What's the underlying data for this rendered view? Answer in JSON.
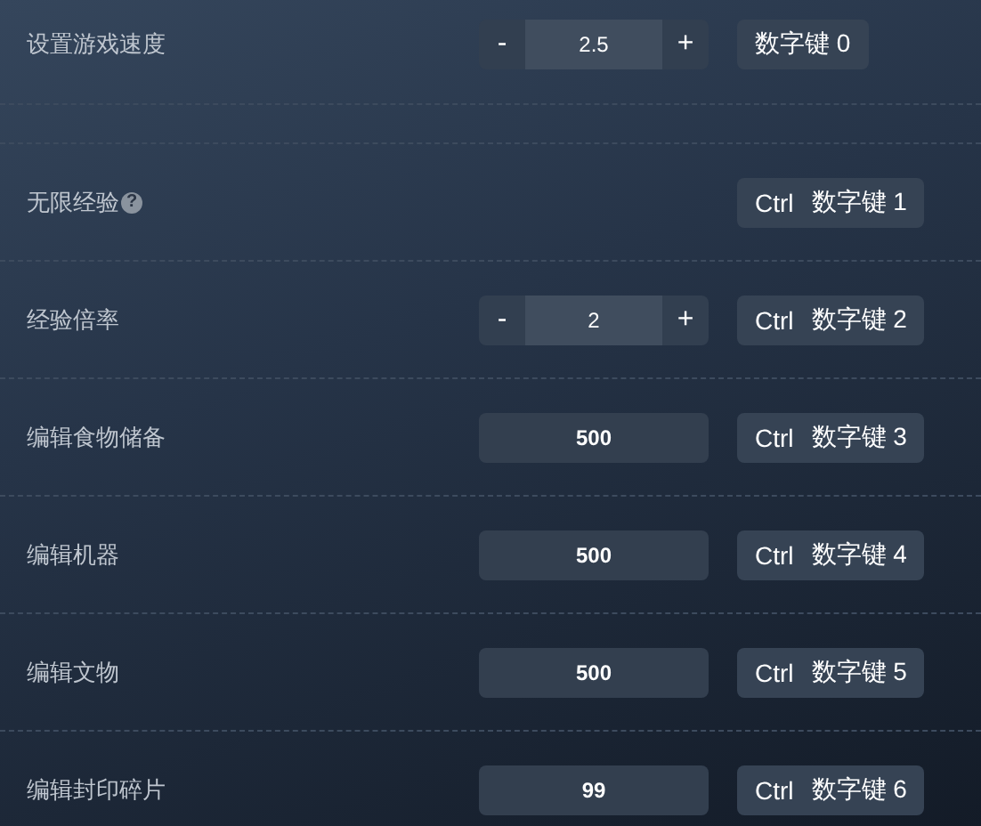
{
  "groups": [
    [
      {
        "label": "设置游戏速度",
        "kind": "stepper",
        "minus": "-",
        "value": "2.5",
        "plus": "+",
        "keys": [
          "数字键 0"
        ]
      }
    ],
    [
      {
        "label": "无限经验",
        "help": "?",
        "kind": "toggle",
        "keys": [
          "Ctrl",
          "数字键 1"
        ]
      },
      {
        "label": "经验倍率",
        "kind": "stepper",
        "minus": "-",
        "value": "2",
        "plus": "+",
        "keys": [
          "Ctrl",
          "数字键 2"
        ]
      },
      {
        "label": "编辑食物储备",
        "kind": "input",
        "value": "500",
        "keys": [
          "Ctrl",
          "数字键 3"
        ]
      },
      {
        "label": "编辑机器",
        "kind": "input",
        "value": "500",
        "keys": [
          "Ctrl",
          "数字键 4"
        ]
      },
      {
        "label": "编辑文物",
        "kind": "input",
        "value": "500",
        "keys": [
          "Ctrl",
          "数字键 5"
        ]
      },
      {
        "label": "编辑封印碎片",
        "kind": "input",
        "value": "99",
        "keys": [
          "Ctrl",
          "数字键 6"
        ]
      }
    ]
  ]
}
